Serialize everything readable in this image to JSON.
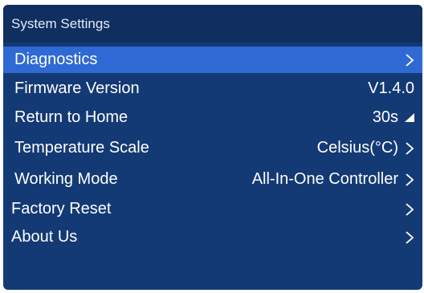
{
  "window": {
    "title": "System Settings"
  },
  "menu": {
    "items": [
      {
        "label": "Diagnostics",
        "value": "",
        "icon": "chevron-right-icon",
        "selected": true
      },
      {
        "label": "Firmware Version",
        "value": "V1.4.0",
        "icon": "",
        "selected": false
      },
      {
        "label": "Return to Home",
        "value": "30s",
        "icon": "triangle-up-icon",
        "selected": false
      },
      {
        "label": "Temperature Scale",
        "value": "Celsius(°C)",
        "icon": "chevron-right-icon",
        "selected": false
      },
      {
        "label": "Working Mode",
        "value": "All-In-One Controller",
        "icon": "chevron-right-icon",
        "selected": false
      },
      {
        "label": "Factory Reset",
        "value": "",
        "icon": "chevron-right-icon",
        "selected": false
      },
      {
        "label": "About Us",
        "value": "",
        "icon": "chevron-right-icon",
        "selected": false
      }
    ]
  },
  "colors": {
    "background": "#143a75",
    "title_bar": "#0f2f60",
    "selected_row": "#2f69d4",
    "text": "#ffffff"
  }
}
